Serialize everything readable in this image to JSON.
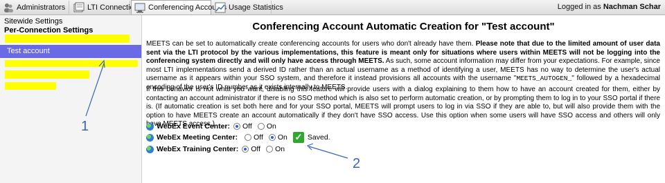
{
  "topbar": {
    "tabs": [
      {
        "label": "Administrators",
        "icon": "users-icon"
      },
      {
        "label": "LTI Connections",
        "icon": "lti-connections-icon"
      },
      {
        "label": "Conferencing Accounts",
        "icon": "conferencing-accounts-icon",
        "active": true
      },
      {
        "label": "Usage Statistics",
        "icon": "chart-icon"
      }
    ],
    "login_prefix": "Logged in as ",
    "login_user": "Nachman Schar"
  },
  "sidebar": {
    "sitewide": "Sitewide Settings",
    "per_connection": "Per-Connection Settings",
    "selected": "Test account",
    "highlight_color": "#ffff00",
    "selected_color": "#6a6ae6"
  },
  "main": {
    "title": "Conferencing Account Automatic Creation for \"Test account\"",
    "para1_a": "MEETS can be set to automatically create conferencing accounts for users who don't already have them. ",
    "para1_b": "Please note that due to the limited amount of user data sent via the LTI protocol by the various implementations, this feature is meant only for situations where users within MEETS will not be logging into the conferencing system directly and will only have access through MEETS.",
    "para1_c": " As such, some account information may differ from your expectations. For example, since most LTI implementations send a derived ID rather than an actual username as a method of identifying a user, MEETS has no way to determine the user's actual username as it appears within your SSO system, and therefore it instead provisions all accounts with the username \"",
    "para1_code": "MEETS_AUTOGEN_",
    "para1_d": "\" followed by a hexadecimal encoding of the user's ID number as it exists internally to MEETS.",
    "para2": "If this behavior is not what you want, disabling this feature will provide users with a dialog explaining to them how to have an account created for them, either by contacting an account administrator if there is no SSO method which is also set to perform automatic creation, or by prompting them to log in to your SSO portal if there is. (If automatic creation is set both here and for your SSO portal, MEETS will prompt users to log in via SSO if they are able to, but will also provide them with the option to have MEETS create an account automatically if they don't have SSO access. Use this option when some users will have SSO access and others will only have MEETS access.)",
    "options": [
      {
        "label": "WebEx Event Center:",
        "off": "Off",
        "on": "On",
        "value": "Off"
      },
      {
        "label": "WebEx Meeting Center:",
        "off": "Off",
        "on": "On",
        "value": "On",
        "status": "Saved."
      },
      {
        "label": "WebEx Training Center:",
        "off": "Off",
        "on": "On",
        "value": "Off"
      }
    ]
  },
  "callouts": {
    "one": "1",
    "two": "2",
    "color": "#3a64b8"
  }
}
